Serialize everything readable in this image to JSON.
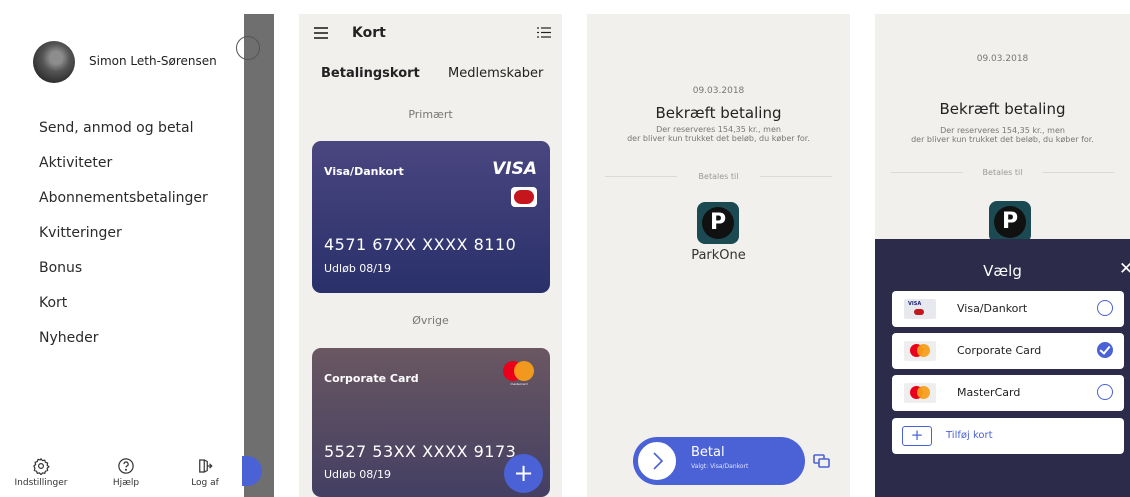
{
  "drawer": {
    "user_name": "Simon Leth-Sørensen",
    "menu": [
      {
        "label": "Send, anmod og betal"
      },
      {
        "label": "Aktiviteter"
      },
      {
        "label": "Abonnementsbetalinger"
      },
      {
        "label": "Kvitteringer"
      },
      {
        "label": "Bonus"
      },
      {
        "label": "Kort"
      },
      {
        "label": "Nyheder"
      }
    ],
    "bottom": {
      "settings": "Indstillinger",
      "help": "Hjælp",
      "logout": "Log af"
    }
  },
  "cards_screen": {
    "title": "Kort",
    "tabs": [
      "Betalingskort",
      "Medlemskaber"
    ],
    "section_primary": "Primært",
    "section_other": "Øvrige",
    "cards": [
      {
        "name": "Visa/Dankort",
        "number": "4571 67XX XXXX 8110",
        "expiry": "Udløb 08/19",
        "brand": "VISA"
      },
      {
        "name": "Corporate Card",
        "number": "5527 53XX XXXX 9173",
        "expiry": "Udløb 08/19",
        "brand_text": "mastercard"
      }
    ],
    "fab_label": "+"
  },
  "confirm_screen": {
    "date": "09.03.2018",
    "title": "Bekræft betaling",
    "note_line1": "Der reserveres 154,35 kr., men",
    "note_line2": "der bliver kun trukket det beløb, du køber for.",
    "pay_to_label": "Betales til",
    "merchant_logo_letter": "P",
    "merchant": "ParkOne",
    "pay_button": {
      "label": "Betal",
      "sub": "Valgt: Visa/Dankort"
    }
  },
  "choose_screen": {
    "date": "09.03.2018",
    "title": "Bekræft betaling",
    "note_line1": "Der reserveres 154,35 kr., men",
    "note_line2": "der bliver kun trukket det beløb, du køber for.",
    "pay_to_label": "Betales til",
    "merchant_logo_letter": "P",
    "sheet_title": "Vælg",
    "close": "✕",
    "options": [
      {
        "label": "Visa/Dankort",
        "selected": false
      },
      {
        "label": "Corporate Card",
        "selected": true
      },
      {
        "label": "MasterCard",
        "selected": false
      }
    ],
    "add_card": "Tilføj kort",
    "add_symbol": "+"
  },
  "colors": {
    "accent": "#4b62d6",
    "sheet": "#2c2c4a",
    "screen_bg": "#f1f0ed"
  }
}
